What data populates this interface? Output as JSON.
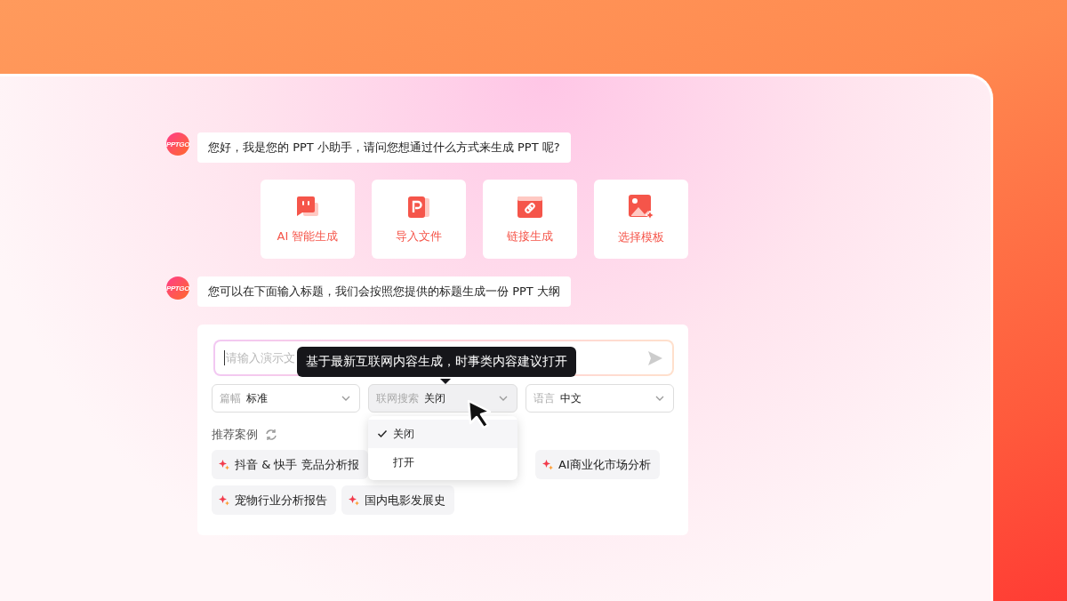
{
  "messages": [
    {
      "avatar": "PPTGO",
      "text": "您好，我是您的 PPT 小助手，请问您想通过什么方式来生成 PPT 呢?"
    },
    {
      "avatar": "PPTGO",
      "text": "您可以在下面输入标题，我们会按照您提供的标题生成一份 PPT 大纲"
    }
  ],
  "options": [
    {
      "kind": "chat",
      "label": "AI 智能生成"
    },
    {
      "kind": "ppt",
      "label": "导入文件"
    },
    {
      "kind": "link",
      "label": "链接生成"
    },
    {
      "kind": "image",
      "label": "选择模板"
    }
  ],
  "input": {
    "placeholder": "请输入演示文"
  },
  "tooltip": "基于最新互联网内容生成，时事类内容建议打开",
  "selects": [
    {
      "label": "篇幅",
      "value": "标准",
      "expanded": false
    },
    {
      "label": "联网搜索",
      "value": "关闭",
      "expanded": true,
      "options": [
        {
          "label": "关闭",
          "selected": true
        },
        {
          "label": "打开",
          "selected": false
        }
      ]
    },
    {
      "label": "语言",
      "value": "中文",
      "expanded": false
    }
  ],
  "examples": {
    "title": "推荐案例",
    "rows": [
      [
        "抖音 & 快手 竞品分析报",
        "AI商业化市场分析"
      ],
      [
        "宠物行业分析报告",
        "国内电影发展史"
      ]
    ]
  }
}
